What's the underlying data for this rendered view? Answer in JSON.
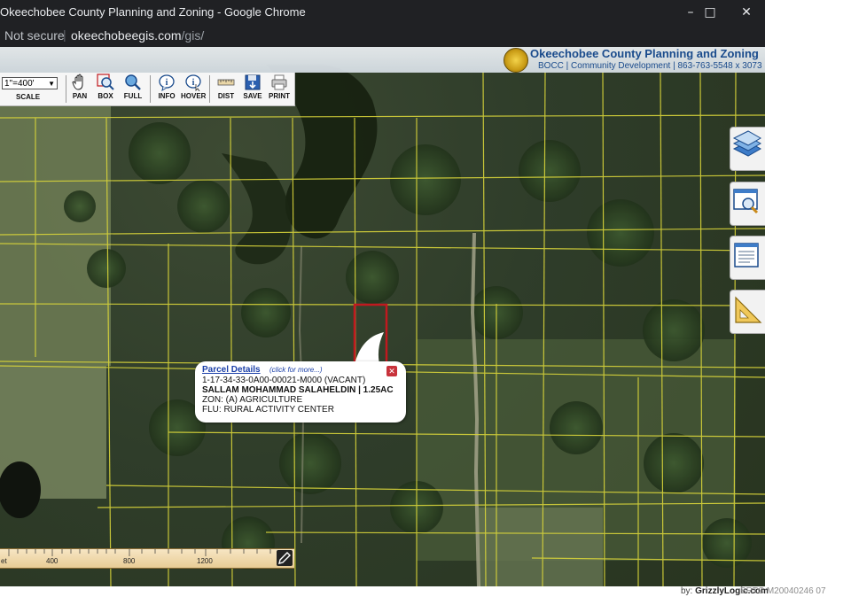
{
  "window": {
    "title": "Okeechobee County Planning and Zoning - Google Chrome",
    "minimize_icon": "minimize-icon",
    "maximize_icon": "maximize-icon",
    "close_icon": "close-icon"
  },
  "address_bar": {
    "security": "Not secure",
    "url_host": "okeechobeegis.com",
    "url_path": "/gis/"
  },
  "site_header": {
    "title": "Okeechobee County Planning and Zoning",
    "subtitle": "BOCC | Community Development | 863-763-5548 x 3073",
    "logo_icon": "county-seal-icon"
  },
  "toolbar": {
    "scale_value": "1\"=400'",
    "scale_label": "SCALE",
    "buttons": [
      {
        "label": "PAN",
        "icon": "hand-icon"
      },
      {
        "label": "BOX",
        "icon": "box-zoom-icon"
      },
      {
        "label": "FULL",
        "icon": "full-extent-icon"
      },
      {
        "label": "INFO",
        "icon": "info-icon"
      },
      {
        "label": "HOVER",
        "icon": "hover-info-icon"
      },
      {
        "label": "DIST",
        "icon": "ruler-icon"
      },
      {
        "label": "SAVE",
        "icon": "save-icon"
      },
      {
        "label": "PRINT",
        "icon": "print-icon"
      }
    ]
  },
  "side_tools": [
    "layers-icon",
    "search-icon",
    "legend-icon",
    "measure-icon"
  ],
  "parcel_popup": {
    "header": "Parcel Details",
    "hint": "(click for more...)",
    "parcel_id": "1-17-34-33-0A00-00021-M000 (VACANT)",
    "owner": "SALLAM MOHAMMAD SALAHELDIN | 1.25AC",
    "zoning": "ZON: (A) AGRICULTURE",
    "flu": "FLU: RURAL ACTIVITY CENTER",
    "close_icon": "close-icon"
  },
  "scale_ruler": {
    "labels": [
      "et",
      "400",
      "800",
      "1200"
    ],
    "edit_icon": "pencil-icon"
  },
  "footer": {
    "credit_prefix": "by: ",
    "credit_name": "GrizzlyLogic.com",
    "watermark": "BRTC M20040246 07"
  },
  "colors": {
    "parcel_lines": "#d8d43a",
    "selected_parcel": "#c0191f",
    "link_blue": "#1a3fa8"
  }
}
